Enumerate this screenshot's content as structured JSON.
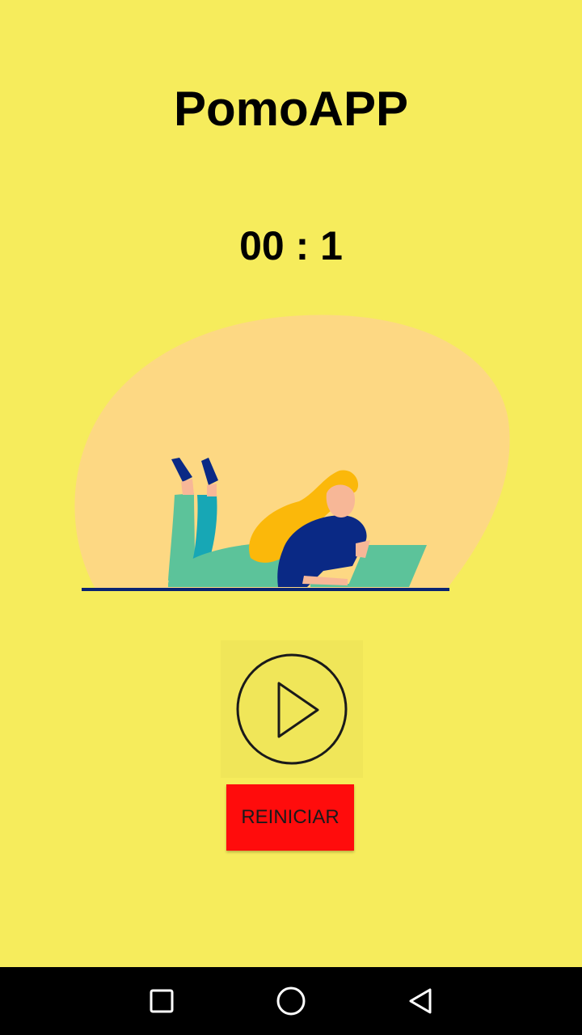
{
  "app": {
    "title": "PomoAPP"
  },
  "timer": {
    "display": "00 : 1"
  },
  "controls": {
    "play_icon": "play-circle-icon",
    "restart_label": "REINICIAR"
  },
  "navbar": {
    "recents_icon": "square-icon",
    "home_icon": "circle-icon",
    "back_icon": "triangle-back-icon"
  },
  "colors": {
    "background": "#f6ec5c",
    "blob": "#fdd883",
    "accent_red": "#ff0c0c",
    "pants_green": "#5cc39a",
    "hair": "#fbb80a",
    "shirt": "#0a2985",
    "skin": "#f7b797"
  }
}
